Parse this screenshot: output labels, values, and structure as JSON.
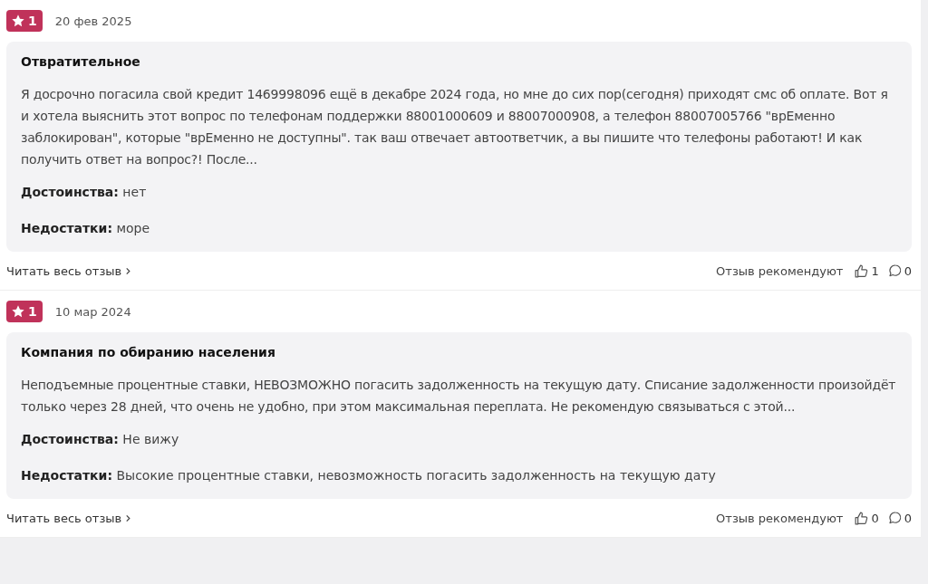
{
  "reviews": [
    {
      "rating": "1",
      "date": "20 фев 2025",
      "title": "Отвратительное",
      "text": "Я досрочно погасила свой кредит 1469998096 ещё в декабре 2024 года, но мне до сих пор(сегодня) приходят смс об оплате. Вот я и хотела выяснить этот вопрос по телефонам поддержки 88001000609 и 88007000908, а телефон 88007005766 \"врЕменно заблокирован\", которые \"врЕменно не доступны\". так ваш отвечает автоответчик, а вы пишите что телефоны работают! И как получить ответ на вопрос?! После...",
      "pros_label": "Достоинства:",
      "pros": "нет",
      "cons_label": "Недостатки:",
      "cons": "море",
      "read_more": "Читать весь отзыв",
      "recommend_label": "Отзыв рекомендуют",
      "likes": "1",
      "comments": "0"
    },
    {
      "rating": "1",
      "date": "10 мар 2024",
      "title": "Компания по обиранию населения",
      "text": "Неподъемные процентные ставки, НЕВОЗМОЖНО погасить задолженность на текущую дату. Списание задолженности произойдёт только через 28 дней, что очень не удобно, при этом максимальная переплата. Не рекомендую связываться с этой...",
      "pros_label": "Достоинства:",
      "pros": "Не вижу",
      "cons_label": "Недостатки:",
      "cons": "Высокие процентные ставки, невозможность погасить задолженность на текущую дату",
      "read_more": "Читать весь отзыв",
      "recommend_label": "Отзыв рекомендуют",
      "likes": "0",
      "comments": "0"
    }
  ]
}
